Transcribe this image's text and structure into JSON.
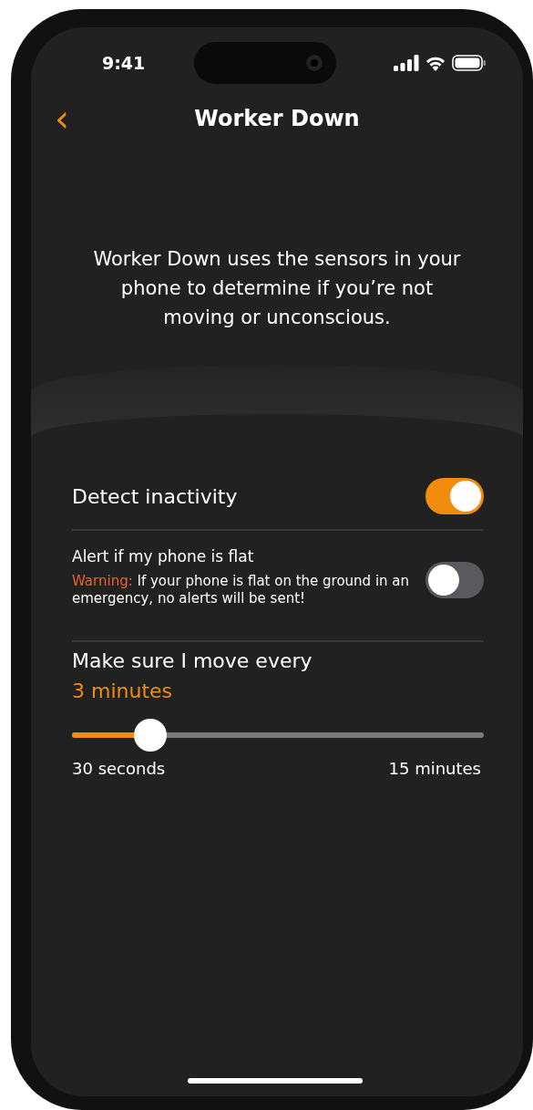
{
  "status_bar": {
    "time": "9:41"
  },
  "nav": {
    "back_icon": "‹",
    "title": "Worker Down"
  },
  "description": "Worker Down uses the sensors in your phone to determine if you’re not moving or unconscious.",
  "settings": [
    {
      "kind": "toggle",
      "label": "Detect inactivity",
      "on": true
    },
    {
      "kind": "toggle_warning",
      "label": "Alert if my phone is flat",
      "warning_label": "Warning:",
      "warning_text": "If your phone is flat on the ground in an emergency, no alerts will be sent!",
      "on": false
    },
    {
      "kind": "slider",
      "label": "Make sure I move every",
      "value": "3 minutes",
      "level": 0.19,
      "min_label": "30 seconds",
      "max_label": "15 minutes"
    }
  ]
}
